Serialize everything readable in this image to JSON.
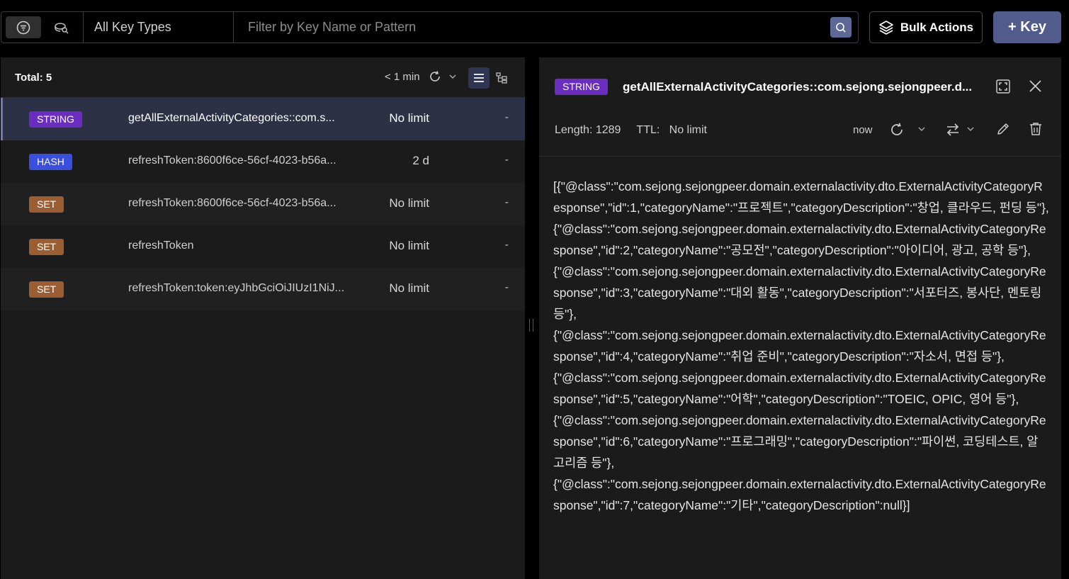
{
  "toolbar": {
    "key_type_filter": "All Key Types",
    "search_placeholder": "Filter by Key Name or Pattern",
    "bulk_actions_label": "Bulk Actions",
    "add_key_label": "+ Key"
  },
  "key_list": {
    "total_label": "Total: 5",
    "last_refresh": "< 1 min",
    "keys": [
      {
        "type": "STRING",
        "name": "getAllExternalActivityCategories::com.s...",
        "ttl": "No limit",
        "size": "-"
      },
      {
        "type": "HASH",
        "name": "refreshToken:8600f6ce-56cf-4023-b56a...",
        "ttl": "2 d",
        "size": "-"
      },
      {
        "type": "SET",
        "name": "refreshToken:8600f6ce-56cf-4023-b56a...",
        "ttl": "No limit",
        "size": "-"
      },
      {
        "type": "SET",
        "name": "refreshToken",
        "ttl": "No limit",
        "size": "-"
      },
      {
        "type": "SET",
        "name": "refreshToken:token:eyJhbGciOiJIUzI1NiJ...",
        "ttl": "No limit",
        "size": "-"
      }
    ]
  },
  "detail": {
    "type": "STRING",
    "key_name": "getAllExternalActivityCategories::com.sejong.sejongpeer.d...",
    "length_label": "Length: 1289",
    "ttl_label": "TTL:",
    "ttl_value": "No limit",
    "last_updated": "now",
    "value": "[{\"@class\":\"com.sejong.sejongpeer.domain.externalactivity.dto.ExternalActivityCategoryResponse\",\"id\":1,\"categoryName\":\"프로젝트\",\"categoryDescription\":\"창업, 클라우드, 펀딩 등\"},\n{\"@class\":\"com.sejong.sejongpeer.domain.externalactivity.dto.ExternalActivityCategoryResponse\",\"id\":2,\"categoryName\":\"공모전\",\"categoryDescription\":\"아이디어, 광고, 공학 등\"},\n{\"@class\":\"com.sejong.sejongpeer.domain.externalactivity.dto.ExternalActivityCategoryResponse\",\"id\":3,\"categoryName\":\"대외 활동\",\"categoryDescription\":\"서포터즈, 봉사단, 멘토링 등\"},\n{\"@class\":\"com.sejong.sejongpeer.domain.externalactivity.dto.ExternalActivityCategoryResponse\",\"id\":4,\"categoryName\":\"취업 준비\",\"categoryDescription\":\"자소서, 면접 등\"},\n{\"@class\":\"com.sejong.sejongpeer.domain.externalactivity.dto.ExternalActivityCategoryResponse\",\"id\":5,\"categoryName\":\"어학\",\"categoryDescription\":\"TOEIC, OPIC, 영어 등\"},\n{\"@class\":\"com.sejong.sejongpeer.domain.externalactivity.dto.ExternalActivityCategoryResponse\",\"id\":6,\"categoryName\":\"프로그래밍\",\"categoryDescription\":\"파이썬, 코딩테스트, 알고리즘 등\"},\n{\"@class\":\"com.sejong.sejongpeer.domain.externalactivity.dto.ExternalActivityCategoryResponse\",\"id\":7,\"categoryName\":\"기타\",\"categoryDescription\":null}]"
  },
  "icons": {
    "filter_view": "filter-icon",
    "search_view": "search-view-icon",
    "search": "search-icon",
    "bulk": "layers-icon",
    "refresh": "refresh-icon",
    "list_view": "list-view-icon",
    "tree_view": "tree-view-icon",
    "expand": "expand-icon",
    "close": "close-icon",
    "format": "swap-icon",
    "edit": "pencil-icon",
    "delete": "trash-icon"
  },
  "colors": {
    "accent": "#515c8c",
    "string_badge": "#6a2dc0",
    "hash_badge": "#3a4ee0",
    "set_badge": "#9a5e32",
    "selected_row": "#2d3145"
  }
}
